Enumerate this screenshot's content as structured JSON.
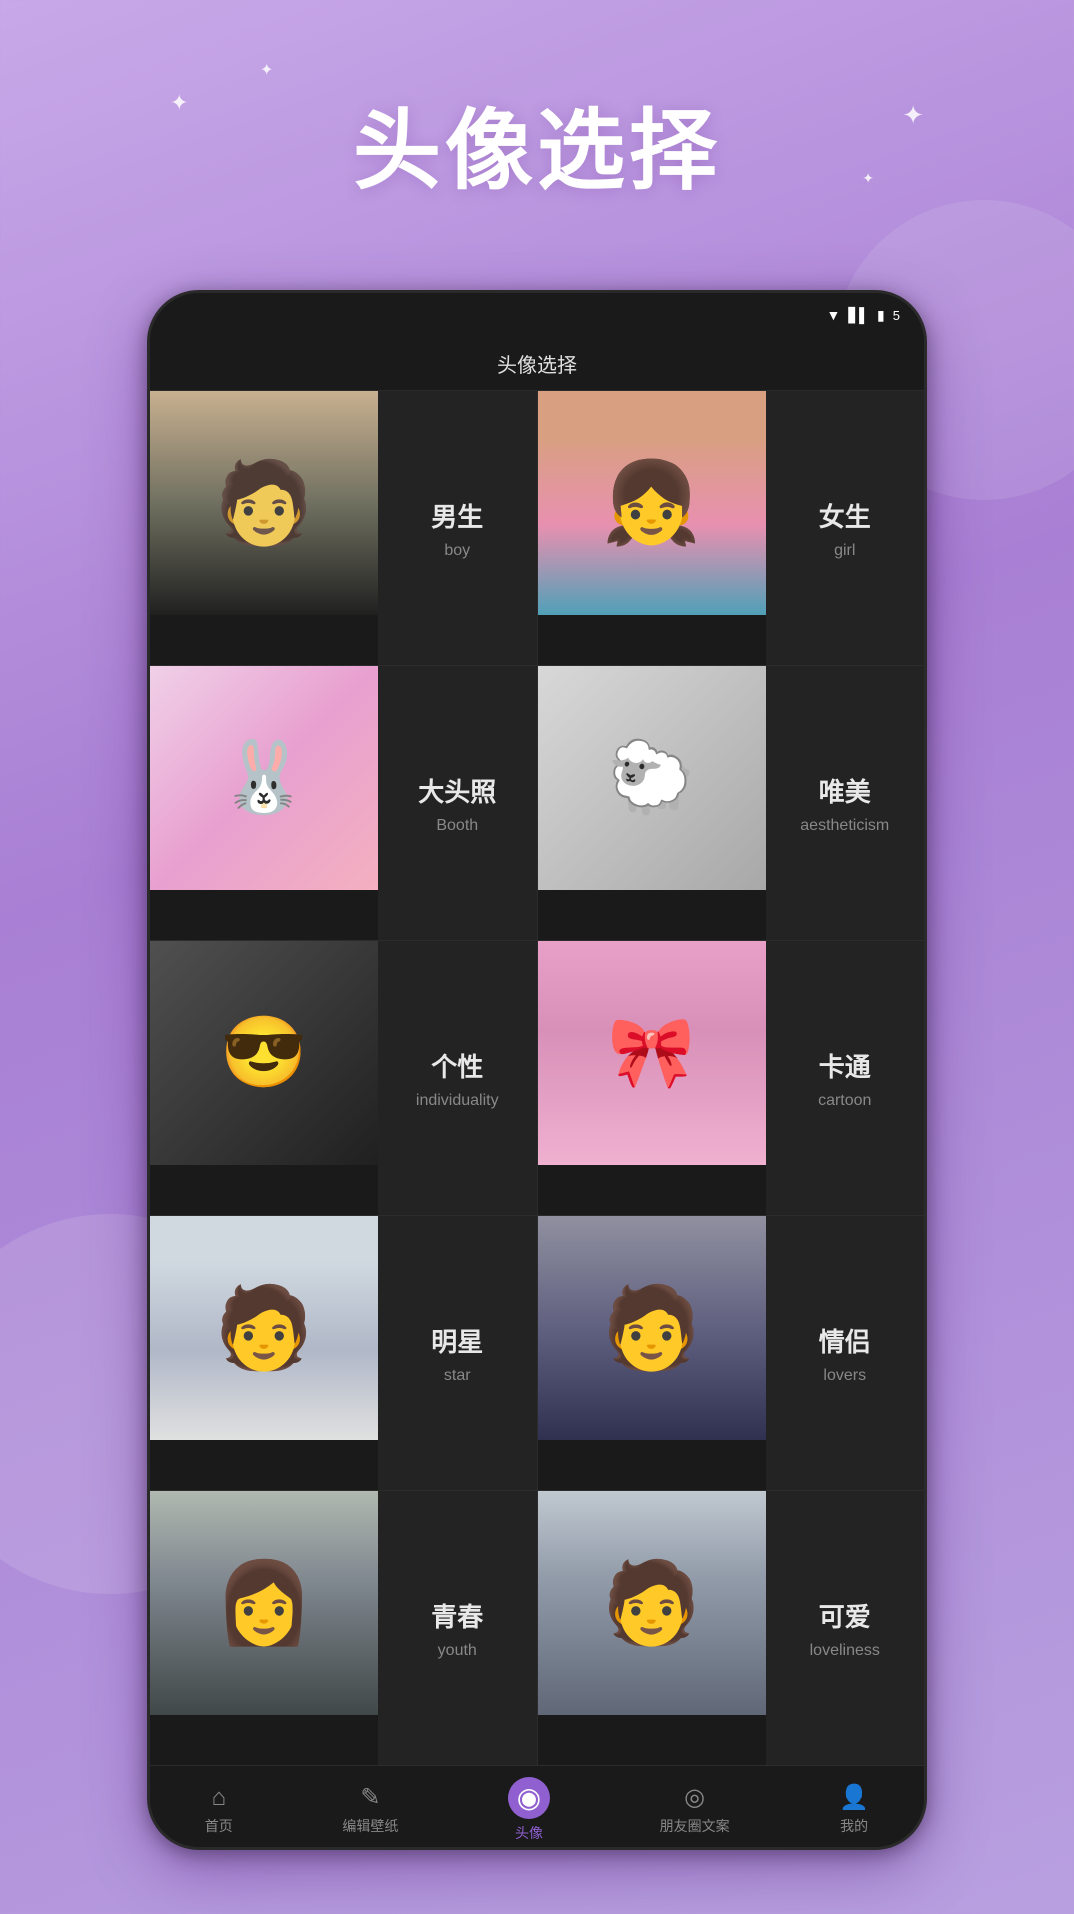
{
  "app": {
    "hero_title": "头像选择",
    "bg_sparkles": [
      "✦",
      "✦",
      "✦",
      "✦"
    ],
    "phone": {
      "status_bar": {
        "wifi": "▼",
        "signal": "▋▋",
        "battery": "🔋",
        "time": "5"
      },
      "top_nav": {
        "title": "头像选择"
      },
      "grid_rows": [
        {
          "id": "row-boy-girl",
          "left_photo_class": "boy-photo",
          "left_emoji": "🧑",
          "left_zh": "男生",
          "left_en": "boy",
          "right_photo_class": "girl-photo",
          "right_emoji": "👧",
          "right_zh": "女生",
          "right_en": "girl"
        },
        {
          "id": "row-booth-aestheticism",
          "left_photo_class": "p3",
          "left_emoji": "🐰",
          "left_zh": "大头照",
          "left_en": "Booth",
          "right_photo_class": "p4",
          "right_emoji": "🐑",
          "right_zh": "唯美",
          "right_en": "aestheticism"
        },
        {
          "id": "row-individuality-cartoon",
          "left_photo_class": "p5",
          "left_emoji": "😎",
          "left_zh": "个性",
          "left_en": "individuality",
          "right_photo_class": "cartoon-photo",
          "right_emoji": "🎀",
          "right_zh": "卡通",
          "right_en": "cartoon"
        },
        {
          "id": "row-star-lovers",
          "left_photo_class": "star-photo",
          "left_emoji": "🧑",
          "left_zh": "明星",
          "left_en": "star",
          "right_photo_class": "lovers-photo",
          "right_emoji": "🧑",
          "right_zh": "情侣",
          "right_en": "lovers"
        },
        {
          "id": "row-youth-cute",
          "left_photo_class": "youth-photo",
          "left_emoji": "👩",
          "left_zh": "青春",
          "left_en": "youth",
          "right_photo_class": "cute-photo",
          "right_emoji": "🧑",
          "right_zh": "可爱",
          "right_en": "loveliness"
        }
      ],
      "bottom_nav": [
        {
          "id": "home",
          "icon": "⌂",
          "label": "首页",
          "active": false
        },
        {
          "id": "edit-wallpaper",
          "icon": "✎",
          "label": "编辑壁纸",
          "active": false
        },
        {
          "id": "avatar",
          "icon": "◉",
          "label": "头像",
          "active": true
        },
        {
          "id": "moments",
          "icon": "◎",
          "label": "朋友圈文案",
          "active": false
        },
        {
          "id": "mine",
          "icon": "👤",
          "label": "我的",
          "active": false
        }
      ]
    }
  }
}
